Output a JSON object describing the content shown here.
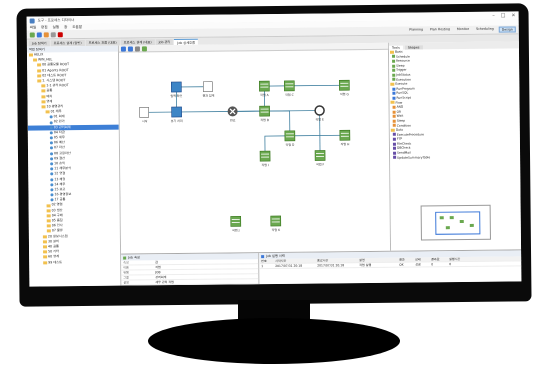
{
  "window": {
    "title": "도구 - 프로세스 디자이너"
  },
  "menu": [
    "파일",
    "편집",
    "실행",
    "창",
    "도움말"
  ],
  "perspectives": [
    {
      "label": "Planning",
      "active": false
    },
    {
      "label": "Plan Hosting",
      "active": false
    },
    {
      "label": "Monitor",
      "active": false
    },
    {
      "label": "Scheduling",
      "active": false
    },
    {
      "label": "Design",
      "active": true
    }
  ],
  "editor_tabs": [
    {
      "label": "Job 탐색기",
      "active": false
    },
    {
      "label": "프로세스 설계 (일반)",
      "active": false
    },
    {
      "label": "프로세스 흐름 (대표)",
      "active": false
    },
    {
      "label": "프로세스 설계 (대표)",
      "active": false
    },
    {
      "label": "Job 관리",
      "active": false
    },
    {
      "label": "Job 상세흐름",
      "active": true
    }
  ],
  "tree": {
    "header": "작업 탐색기",
    "items": [
      {
        "label": "HELIX",
        "level": 0,
        "kind": "folder"
      },
      {
        "label": "WIN_HEL",
        "level": 1,
        "kind": "folder"
      },
      {
        "label": "00 공통모듈 ROOT",
        "level": 2,
        "kind": "folder"
      },
      {
        "label": "01 Agents ROOT",
        "level": 2,
        "kind": "folder"
      },
      {
        "label": "02 테스트 ROOT",
        "level": 2,
        "kind": "folder"
      },
      {
        "label": "1. 시스템 ROOT",
        "level": 2,
        "kind": "folder"
      },
      {
        "label": "1-1 관리 ROOT",
        "level": 3,
        "kind": "folder"
      },
      {
        "label": "공통",
        "level": 3,
        "kind": "folder"
      },
      {
        "label": "배치",
        "level": 3,
        "kind": "folder"
      },
      {
        "label": "연계",
        "level": 3,
        "kind": "folder"
      },
      {
        "label": "10 경영관리",
        "level": 3,
        "kind": "folder"
      },
      {
        "label": "01 재무",
        "level": 4,
        "kind": "folder"
      },
      {
        "label": "01 회계",
        "level": 5,
        "kind": "node"
      },
      {
        "label": "02 원가",
        "level": 5,
        "kind": "node"
      },
      {
        "label": "03 관리회계",
        "level": 5,
        "kind": "node",
        "selected": true
      },
      {
        "label": "04 자금",
        "level": 5,
        "kind": "node"
      },
      {
        "label": "05 세무",
        "level": 5,
        "kind": "node"
      },
      {
        "label": "06 예산",
        "level": 5,
        "kind": "node"
      },
      {
        "label": "07 자산",
        "level": 5,
        "kind": "node"
      },
      {
        "label": "08 고정자산",
        "level": 5,
        "kind": "node"
      },
      {
        "label": "09 결산",
        "level": 5,
        "kind": "node"
      },
      {
        "label": "10 손익",
        "level": 5,
        "kind": "node"
      },
      {
        "label": "11 재무분석",
        "level": 5,
        "kind": "node"
      },
      {
        "label": "12 연결",
        "level": 5,
        "kind": "node"
      },
      {
        "label": "13 채권",
        "level": 5,
        "kind": "node"
      },
      {
        "label": "14 채무",
        "level": 5,
        "kind": "node"
      },
      {
        "label": "15 보고",
        "level": 5,
        "kind": "node"
      },
      {
        "label": "16 경영정보",
        "level": 5,
        "kind": "node"
      },
      {
        "label": "17 공통",
        "level": 5,
        "kind": "node"
      },
      {
        "label": "02 영업",
        "level": 4,
        "kind": "folder"
      },
      {
        "label": "03 생산",
        "level": 4,
        "kind": "folder"
      },
      {
        "label": "04 구매",
        "level": 4,
        "kind": "folder"
      },
      {
        "label": "05 품질",
        "level": 4,
        "kind": "folder"
      },
      {
        "label": "06 인사",
        "level": 4,
        "kind": "folder"
      },
      {
        "label": "07 물류",
        "level": 4,
        "kind": "folder"
      },
      {
        "label": "20 정보시스템",
        "level": 3,
        "kind": "folder"
      },
      {
        "label": "30 설비",
        "level": 3,
        "kind": "folder"
      },
      {
        "label": "40 공통",
        "level": 3,
        "kind": "folder"
      },
      {
        "label": "50 기타",
        "level": 3,
        "kind": "folder"
      },
      {
        "label": "60 연계",
        "level": 3,
        "kind": "folder"
      },
      {
        "label": "99 테스트",
        "level": 3,
        "kind": "folder"
      }
    ]
  },
  "palette": {
    "tabs": [
      "Tools",
      "Shapes"
    ],
    "groups": [
      {
        "label": "Basic",
        "items": [
          "Schedule",
          "Resource",
          "Sleep",
          "Trigger",
          "JobStatus",
          "Execution"
        ]
      },
      {
        "label": "Execute",
        "items": [
          "RunProgram",
          "RunSQL",
          "RunScript"
        ]
      },
      {
        "label": "Flow",
        "items": [
          "AND",
          "OR",
          "Wait",
          "Sleep",
          "Condition"
        ]
      },
      {
        "label": "Data",
        "items": [
          "ExecuteProcedure",
          "FTP",
          "FileCheck",
          "DBCheck",
          "SendMail",
          "UpdateSummaryTable"
        ]
      }
    ]
  },
  "canvas_nodes": [
    "시작",
    "입력 확인",
    "분기 처리",
    "결과 집계",
    "완료",
    "작업 A",
    "작업 B",
    "작업 C",
    "작업 D",
    "작업 E",
    "작업 F",
    "작업 G",
    "작업 H",
    "작업 I",
    "작업 J",
    "작업 K"
  ],
  "properties": {
    "header": "Job 속성",
    "rows": [
      {
        "k": "속성",
        "v": "값"
      },
      {
        "k": "이름",
        "v": "작업"
      },
      {
        "k": "유형",
        "v": "JOB"
      },
      {
        "k": "그룹",
        "v": "관리회계"
      },
      {
        "k": "설명",
        "v": "재무 관리 작업"
      },
      {
        "k": "상태",
        "v": "활성"
      }
    ]
  },
  "log": {
    "header": "Job 실행 이력",
    "columns": [
      "번호",
      "시작시간",
      "종료시간",
      "설명",
      "결과",
      "상태",
      "결과값",
      "실행시간"
    ],
    "rows": [
      [
        "1",
        "2017/07/31 20:18",
        "2017/07/31 20:18",
        "작업 실행",
        "OK",
        "성공",
        "0",
        "0"
      ]
    ]
  }
}
